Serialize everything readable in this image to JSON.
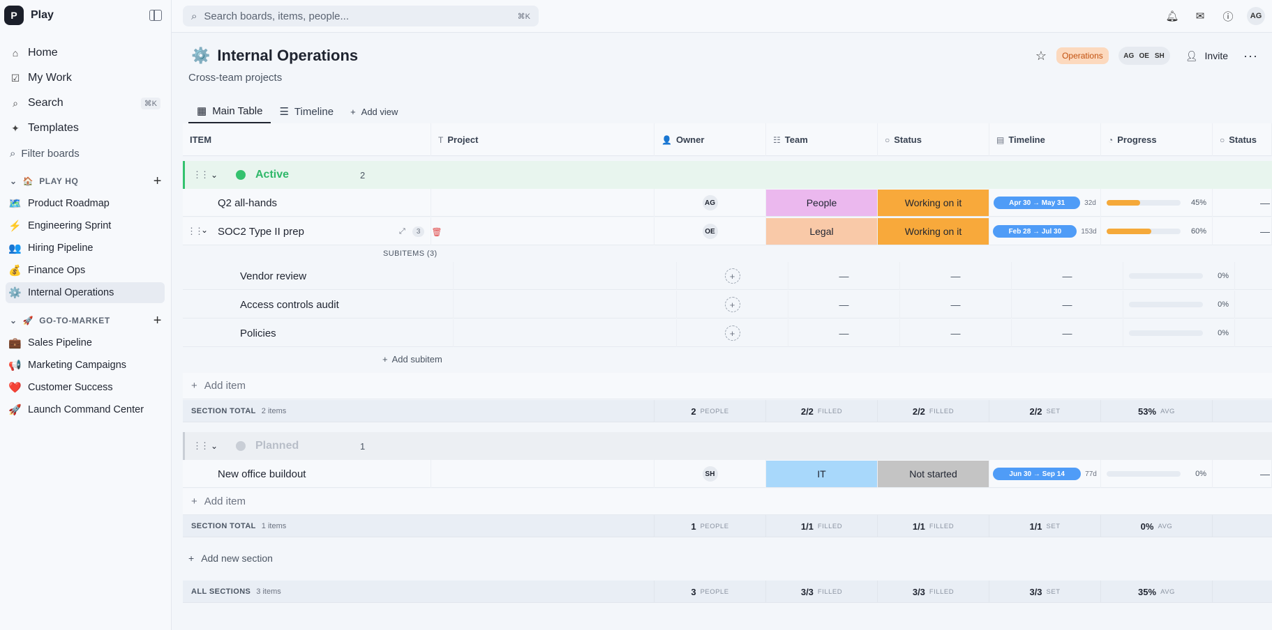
{
  "brand": {
    "logo": "P",
    "name": "Play"
  },
  "nav": [
    {
      "icon": "⌂",
      "label": "Home"
    },
    {
      "icon": "☑",
      "label": "My Work"
    },
    {
      "icon": "⌕",
      "label": "Search",
      "shortcut": "⌘K"
    },
    {
      "icon": "✦",
      "label": "Templates"
    }
  ],
  "filter_placeholder": "Filter boards",
  "groups": [
    {
      "emoji": "🏠",
      "title": "PLAY HQ",
      "boards": [
        {
          "emoji": "🗺️",
          "label": "Product Roadmap"
        },
        {
          "emoji": "⚡",
          "label": "Engineering Sprint"
        },
        {
          "emoji": "👥",
          "label": "Hiring Pipeline"
        },
        {
          "emoji": "💰",
          "label": "Finance Ops"
        },
        {
          "emoji": "⚙️",
          "label": "Internal Operations",
          "active": true
        }
      ]
    },
    {
      "emoji": "🚀",
      "title": "GO-TO-MARKET",
      "boards": [
        {
          "emoji": "💼",
          "label": "Sales Pipeline"
        },
        {
          "emoji": "📢",
          "label": "Marketing Campaigns"
        },
        {
          "emoji": "❤️",
          "label": "Customer Success"
        },
        {
          "emoji": "🚀",
          "label": "Launch Command Center"
        }
      ]
    }
  ],
  "topbar": {
    "search_placeholder": "Search boards, items, people...",
    "search_shortcut": "⌘K",
    "user_initials": "AG"
  },
  "board": {
    "emoji": "⚙️",
    "title": "Internal Operations",
    "subtitle": "Cross-team projects",
    "tag": "Operations",
    "members": [
      "AG",
      "OE",
      "SH"
    ],
    "invite_label": "Invite",
    "more": "···"
  },
  "tabs": [
    {
      "icon": "▦",
      "label": "Main Table",
      "active": true
    },
    {
      "icon": "☰",
      "label": "Timeline"
    },
    {
      "icon": "+",
      "label": "Add view"
    }
  ],
  "columns": [
    {
      "icon": "",
      "label": "ITEM"
    },
    {
      "icon": "T",
      "label": "Project"
    },
    {
      "icon": "👤",
      "label": "Owner"
    },
    {
      "icon": "☷",
      "label": "Team"
    },
    {
      "icon": "○",
      "label": "Status"
    },
    {
      "icon": "▤",
      "label": "Timeline"
    },
    {
      "icon": "◔",
      "label": "Progress"
    },
    {
      "icon": "○",
      "label": "Status"
    }
  ],
  "sections": [
    {
      "name": "Active",
      "count": "2",
      "color": "#34c26e",
      "name_color": "#2fb869",
      "items": [
        {
          "name": "Q2 all-hands",
          "owner": "AG",
          "team": "People",
          "team_color": "#ebb8ee",
          "status": "Working on it",
          "status_color": "#f8a93b",
          "timeline": "Apr 30 → May 31",
          "days": "32d",
          "progress": 45,
          "progress_label": "45%",
          "end": "—"
        },
        {
          "name": "SOC2 Type II prep",
          "owner": "OE",
          "team": "Legal",
          "team_color": "#f9c9a8",
          "status": "Working on it",
          "status_color": "#f8a93b",
          "timeline": "Feb 28 → Jul 30",
          "days": "153d",
          "progress": 60,
          "progress_label": "60%",
          "end": "—",
          "subcount": "3"
        }
      ],
      "subitems_label": "SUBITEMS (3)",
      "subitems": [
        {
          "name": "Vendor review",
          "progress_label": "0%"
        },
        {
          "name": "Access controls audit",
          "progress_label": "0%"
        },
        {
          "name": "Policies",
          "progress_label": "0%"
        }
      ],
      "add_subitem": "Add subitem",
      "add_item": "Add item",
      "total": {
        "label": "SECTION TOTAL",
        "items": "2 items",
        "owner": "2",
        "owner_unit": "PEOPLE",
        "team": "2/2",
        "team_unit": "FILLED",
        "status": "2/2",
        "status_unit": "FILLED",
        "timeline": "2/2",
        "timeline_unit": "SET",
        "progress": "53%",
        "progress_unit": "AVG"
      }
    },
    {
      "name": "Planned",
      "count": "1",
      "color": "#c9ced6",
      "name_color": "#b8bec8",
      "items": [
        {
          "name": "New office buildout",
          "owner": "SH",
          "team": "IT",
          "team_color": "#a8d8fb",
          "status": "Not started",
          "status_color": "#c4c4c4",
          "timeline": "Jun 30 → Sep 14",
          "days": "77d",
          "progress": 0,
          "progress_label": "0%",
          "end": "—"
        }
      ],
      "add_item": "Add item",
      "total": {
        "label": "SECTION TOTAL",
        "items": "1 items",
        "owner": "1",
        "owner_unit": "PEOPLE",
        "team": "1/1",
        "team_unit": "FILLED",
        "status": "1/1",
        "status_unit": "FILLED",
        "timeline": "1/1",
        "timeline_unit": "SET",
        "progress": "0%",
        "progress_unit": "AVG"
      }
    }
  ],
  "add_section": "Add new section",
  "grand_total": {
    "label": "ALL SECTIONS",
    "items": "3 items",
    "owner": "3",
    "owner_unit": "PEOPLE",
    "team": "3/3",
    "team_unit": "FILLED",
    "status": "3/3",
    "status_unit": "FILLED",
    "timeline": "3/3",
    "timeline_unit": "SET",
    "progress": "35%",
    "progress_unit": "AVG"
  }
}
